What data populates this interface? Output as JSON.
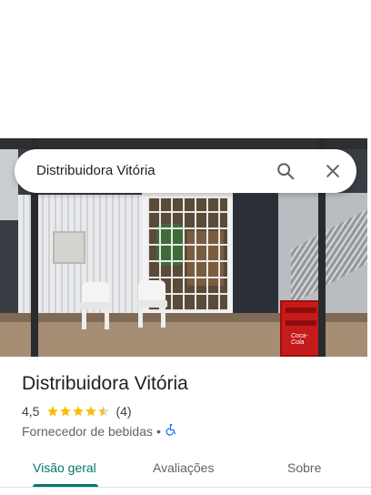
{
  "search": {
    "query": "Distribuidora Vitória"
  },
  "icons": {
    "search": "search-icon",
    "close": "close-icon",
    "accessibility": "wheelchair-icon",
    "star": "star-icon"
  },
  "photo": {
    "crate_brand": "Coca-Cola"
  },
  "place": {
    "name": "Distribuidora Vitória",
    "rating": "4,5",
    "rating_value": 4.5,
    "max_stars": 5,
    "review_count": "(4)",
    "category": "Fornecedor de bebidas",
    "separator": "•"
  },
  "tabs": [
    {
      "label": "Visão geral",
      "active": true
    },
    {
      "label": "Avaliações",
      "active": false
    },
    {
      "label": "Sobre",
      "active": false
    }
  ],
  "colors": {
    "accent": "#00796b",
    "star": "#fbbc04",
    "star_empty": "#dadce0",
    "accessibility": "#1a73e8"
  }
}
